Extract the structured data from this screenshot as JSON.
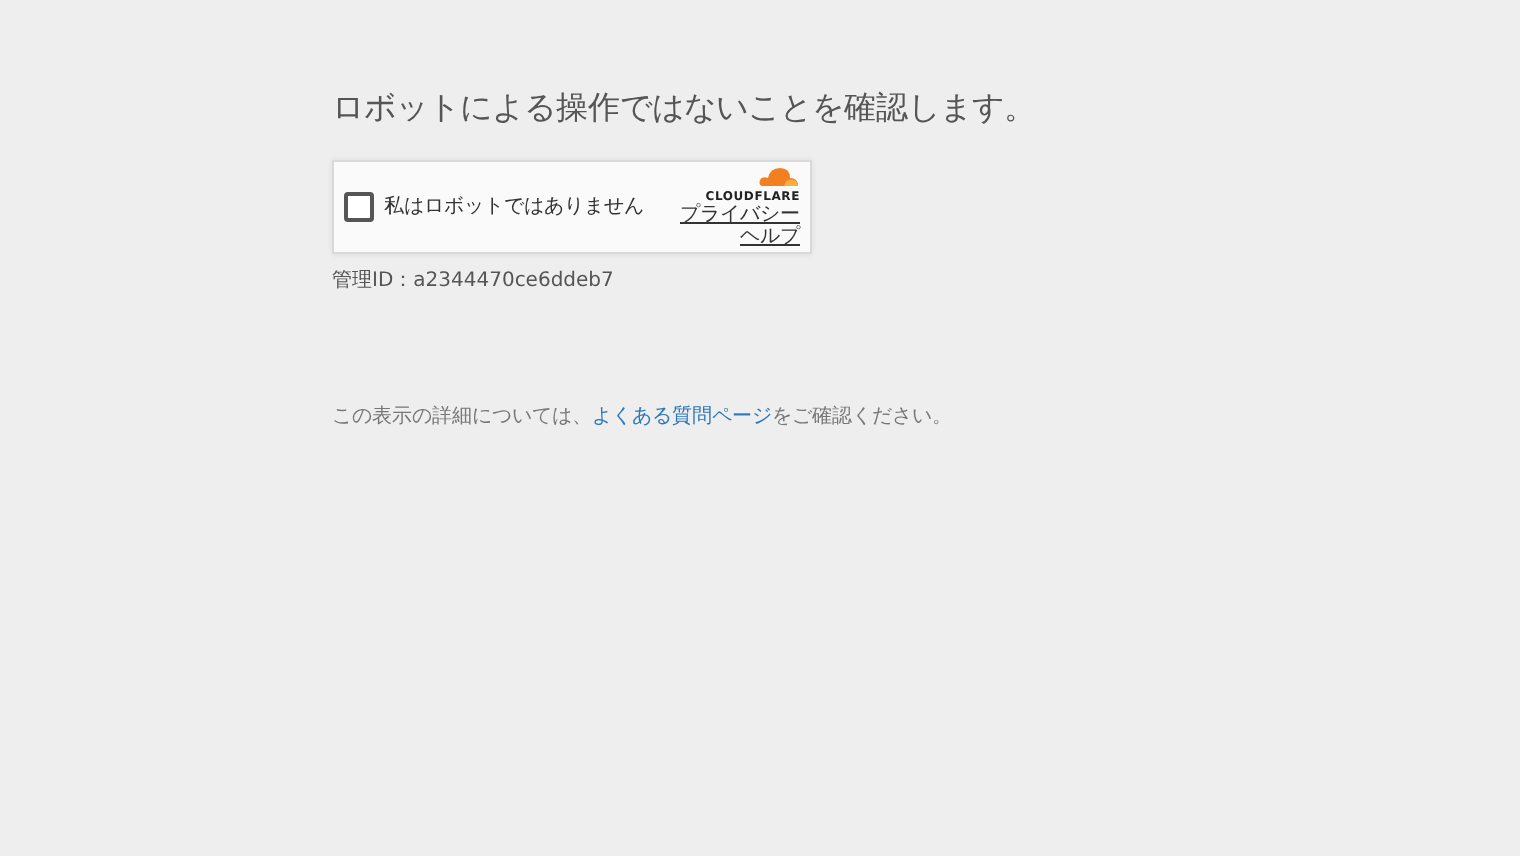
{
  "heading": "ロボットによる操作ではないことを確認します。",
  "widget": {
    "checkbox_label": "私はロボットではありません",
    "checked": false,
    "brand": "CLOUDFLARE",
    "links": [
      "プライバシー",
      "ヘルプ"
    ]
  },
  "ray_id": "管理ID：a2344470ce6ddeb7",
  "footer": {
    "before": "この表示の詳細については、",
    "link": "よくある質問ページ",
    "after": "をご確認ください。"
  }
}
